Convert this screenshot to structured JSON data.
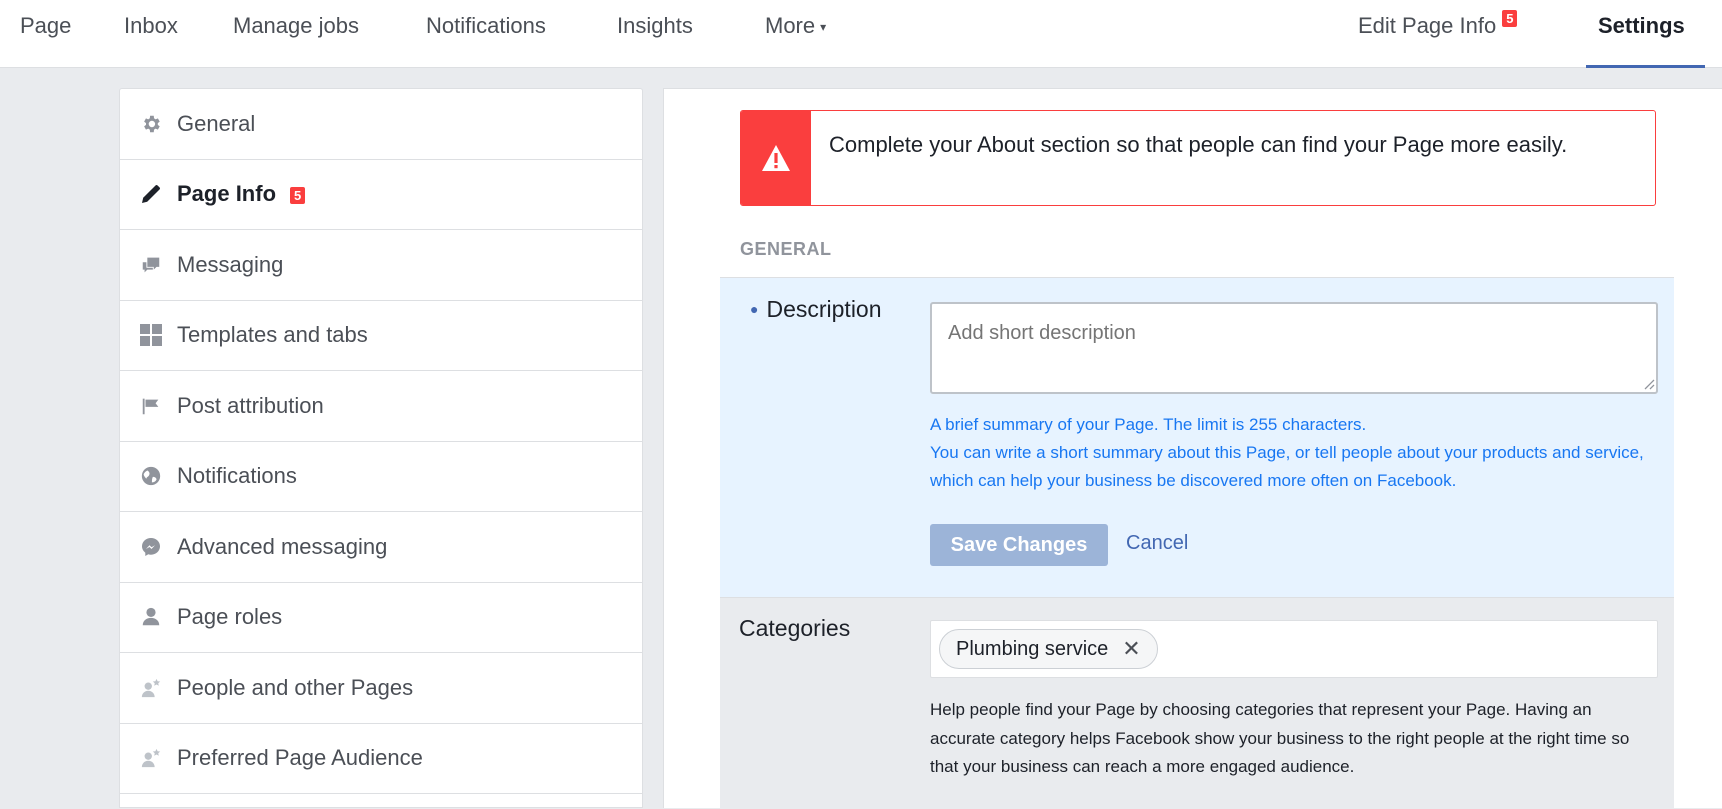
{
  "topnav": {
    "items": [
      "Page",
      "Inbox",
      "Manage jobs",
      "Notifications",
      "Insights",
      "More"
    ],
    "more_caret": "▾",
    "edit_page_info": "Edit Page Info",
    "edit_badge": "5",
    "settings": "Settings"
  },
  "sidebar": {
    "items": [
      {
        "label": "General",
        "icon": "gear-icon"
      },
      {
        "label": "Page Info",
        "icon": "pencil-icon",
        "badge": "5"
      },
      {
        "label": "Messaging",
        "icon": "chat-bubbles-icon"
      },
      {
        "label": "Templates and tabs",
        "icon": "grid-icon"
      },
      {
        "label": "Post attribution",
        "icon": "flag-icon"
      },
      {
        "label": "Notifications",
        "icon": "globe-icon"
      },
      {
        "label": "Advanced messaging",
        "icon": "messenger-icon"
      },
      {
        "label": "Page roles",
        "icon": "person-icon"
      },
      {
        "label": "People and other Pages",
        "icon": "person-star-icon"
      },
      {
        "label": "Preferred Page Audience",
        "icon": "person-star-icon"
      }
    ]
  },
  "main": {
    "alert_text": "Complete your About section so that people can find your Page more easily.",
    "section_title": "GENERAL",
    "description": {
      "label": "Description",
      "placeholder": "Add short description",
      "help_line1": "A brief summary of your Page. The limit is 255 characters.",
      "help_line2": "You can write a short summary about this Page, or tell people about your products and service, which can help your business be discovered more often on Facebook.",
      "save_label": "Save Changes",
      "cancel_label": "Cancel"
    },
    "categories": {
      "label": "Categories",
      "chip": "Plumbing service",
      "help": "Help people find your Page by choosing categories that represent your Page. Having an accurate category helps Facebook show your business to the right people at the right time so that your business can reach a more engaged audience."
    }
  },
  "colors": {
    "accent": "#4267b2",
    "alert_red": "#fa3e3e",
    "help_blue": "#1877f2",
    "highlight_bg": "#e7f3ff"
  }
}
